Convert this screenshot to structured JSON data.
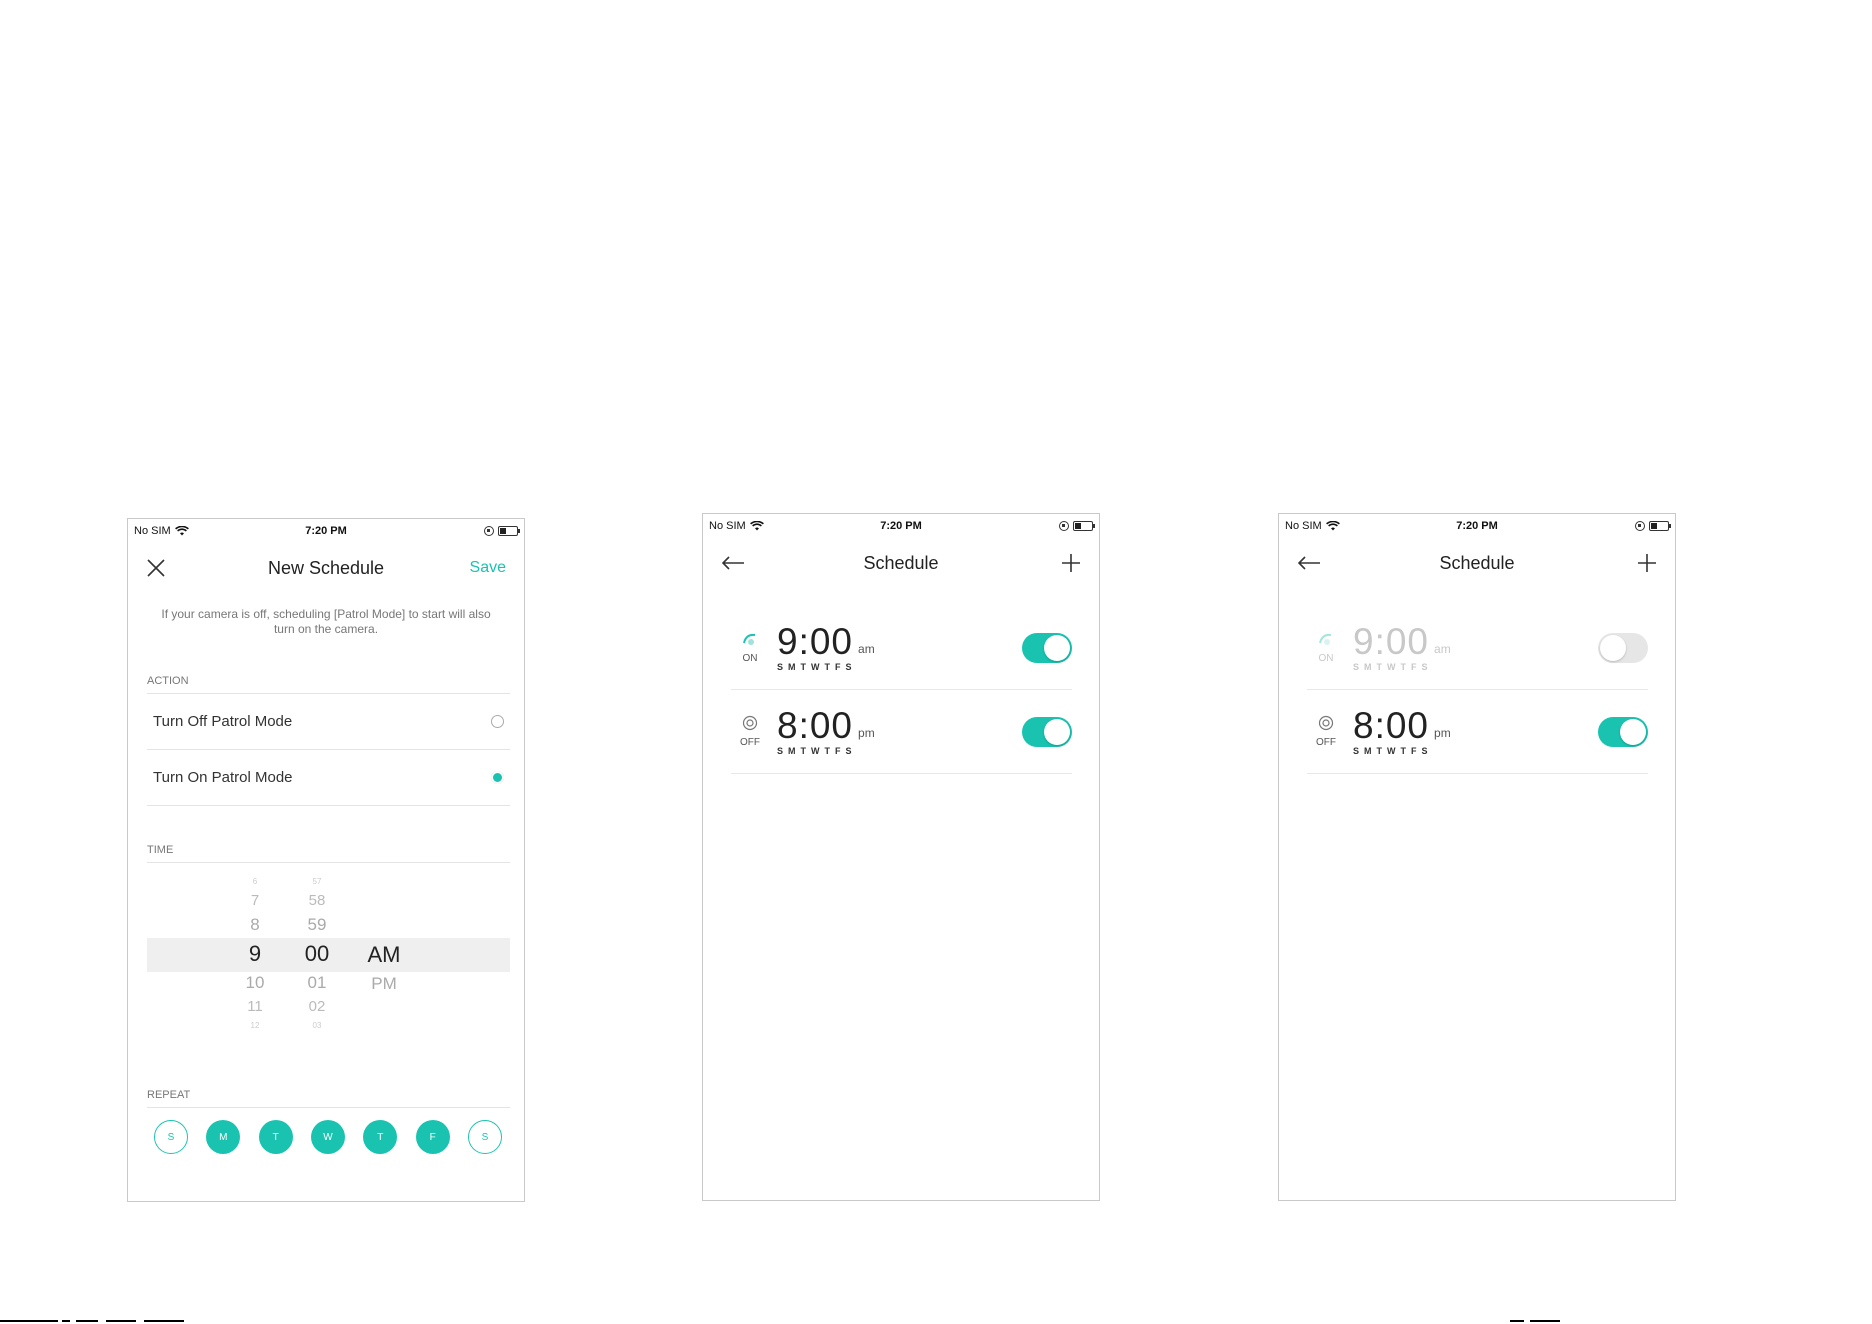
{
  "status_bar": {
    "carrier": "No SIM",
    "time": "7:20 PM"
  },
  "screen1": {
    "title": "New Schedule",
    "save_label": "Save",
    "notice": "If your camera is off, scheduling [Patrol Mode] to start will also turn on the camera.",
    "action_label": "ACTION",
    "actions": [
      {
        "label": "Turn Off Patrol Mode",
        "selected": false
      },
      {
        "label": "Turn On Patrol Mode",
        "selected": true
      }
    ],
    "time_label": "TIME",
    "picker": {
      "hours": [
        "6",
        "7",
        "8",
        "9",
        "10",
        "11",
        "12"
      ],
      "minutes": [
        "57",
        "58",
        "59",
        "00",
        "01",
        "02",
        "03"
      ],
      "ampm": [
        "AM",
        "PM"
      ]
    },
    "repeat_label": "REPEAT",
    "days": [
      {
        "label": "S",
        "on": false
      },
      {
        "label": "M",
        "on": true
      },
      {
        "label": "T",
        "on": true
      },
      {
        "label": "W",
        "on": true
      },
      {
        "label": "T",
        "on": true
      },
      {
        "label": "F",
        "on": true
      },
      {
        "label": "S",
        "on": false
      }
    ]
  },
  "screen2": {
    "title": "Schedule",
    "items": [
      {
        "mode": "ON",
        "time": "9:00",
        "ampm": "am",
        "days": "SMTWTFS",
        "enabled": true
      },
      {
        "mode": "OFF",
        "time": "8:00",
        "ampm": "pm",
        "days": "SMTWTFS",
        "enabled": true
      }
    ]
  },
  "screen3": {
    "title": "Schedule",
    "items": [
      {
        "mode": "ON",
        "time": "9:00",
        "ampm": "am",
        "days": "SMTWTFS",
        "enabled": false
      },
      {
        "mode": "OFF",
        "time": "8:00",
        "ampm": "pm",
        "days": "SMTWTFS",
        "enabled": true
      }
    ]
  },
  "colors": {
    "accent": "#19c3b0",
    "toggle_off": "#e6e6e6",
    "border": "#c9c9c9"
  }
}
